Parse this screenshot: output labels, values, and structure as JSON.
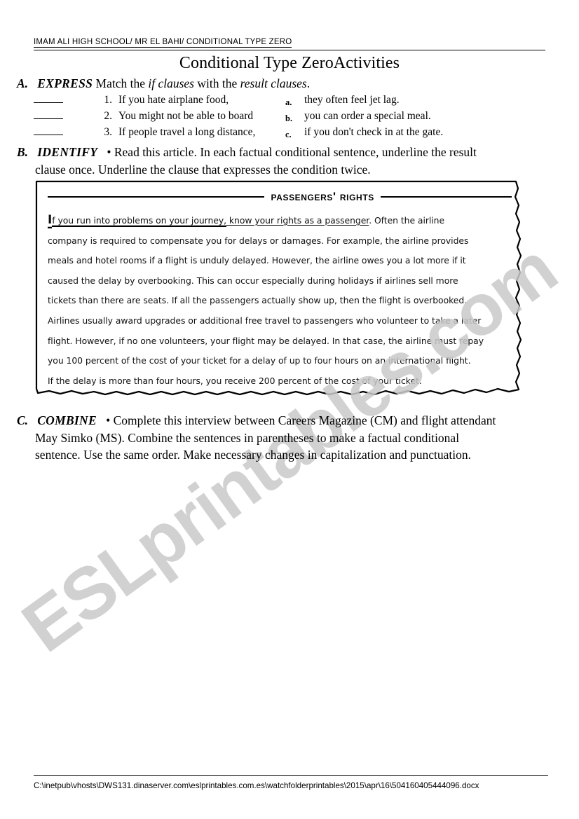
{
  "header": {
    "school_line": "IMAM ALI HIGH SCHOOL/ MR EL BAHI/ CONDITIONAL TYPE ZERO",
    "title": "Conditional Type ZeroActivities"
  },
  "watermark": {
    "text": "ESLprintables.com",
    "color": "#c9c9c9"
  },
  "exercise_a": {
    "letter": "A.",
    "keyword": "EXPRESS",
    "instruction_part1": "Match the ",
    "instruction_italic1": "if clauses",
    "instruction_part2": " with the ",
    "instruction_italic2": "result clauses",
    "instruction_part3": ".",
    "rows": [
      {
        "number": "1.",
        "if_clause": "If you hate airplane food,",
        "letter": "a.",
        "result_clause": "they often feel jet lag."
      },
      {
        "number": "2.",
        "if_clause": "You might not be able to board",
        "letter": "b.",
        "result_clause": "you can order a special meal."
      },
      {
        "number": "3.",
        "if_clause": "If people travel a long distance,",
        "letter": "c.",
        "result_clause": "if you don't check in at the gate."
      }
    ]
  },
  "exercise_b": {
    "letter": "B.",
    "keyword": "IDENTIFY",
    "bullet": "•",
    "line1": " Read this article. In each factual conditional sentence, underline the result",
    "line2": "clause once. Underline the clause that expresses the condition twice."
  },
  "article": {
    "title": "Passengers' Rights",
    "dropcap": "I",
    "underline_twice": "f you run into problems on your journey,",
    "underline_once": " know your rights as a passenger",
    "paragraphs": [
      ". Often the airline",
      "company is required to compensate you for delays or damages. For example, the airline provides",
      "meals and hotel rooms if a flight is unduly delayed. However, the airline owes you a lot more if it",
      "caused the delay by overbooking. This can occur especially during holidays if airlines sell more",
      "tickets than there are seats. If all the passengers actually show up, then the flight is overbooked.",
      "Airlines usually award upgrades or additional free travel to passengers who volunteer to take a later",
      "flight. However, if no one volunteers, your flight may be delayed. In that case, the airline must repay",
      "you 100 percent of the cost of your ticket for a delay of up to four hours on an international flight.",
      "If the delay is more than four hours, you receive 200 percent of the cost of your ticket."
    ]
  },
  "exercise_c": {
    "letter": "C.",
    "keyword": "COMBINE",
    "bullet": "•",
    "line1": " Complete this interview between Careers Magazine (CM)  and  flight attendant",
    "line2": "May Simko  (MS).  Combine the sentences in parentheses to make a factual conditional",
    "line3": "sentence.  Use the same order. Make necessary changes in capitalization and punctuation."
  },
  "footer": {
    "path": "C:\\inetpub\\vhosts\\DWS131.dinaserver.com\\eslprintables.com.es\\watchfolderprintables\\2015\\apr\\16\\504160405444096.docx"
  }
}
